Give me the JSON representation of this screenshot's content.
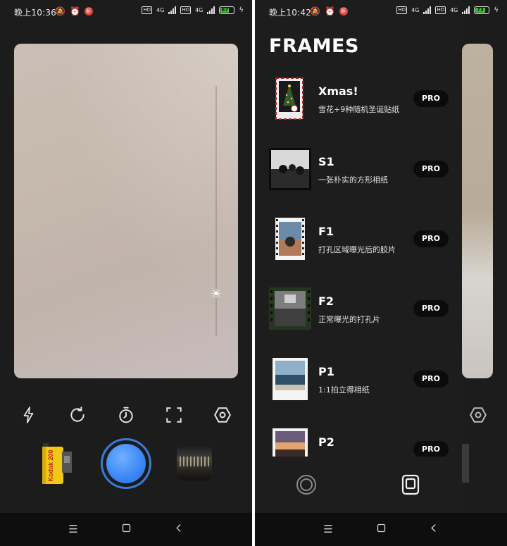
{
  "left": {
    "status": {
      "time": "晚上10:36",
      "notif_badge": "昕",
      "battery": "67",
      "net": "4G"
    },
    "toolbar_icons": [
      "flash-icon",
      "rotate-icon",
      "timer-icon",
      "crop-icon",
      "hexagon-settings-icon"
    ],
    "film_label": "Kodak 200"
  },
  "right": {
    "status": {
      "time": "晚上10:42",
      "notif_badge": "昕",
      "battery": "73",
      "net": "4G"
    },
    "drawer": {
      "title": "FRAMES",
      "items": [
        {
          "name": "Xmas!",
          "desc": "雪花+9种随机圣诞贴纸",
          "badge": "PRO"
        },
        {
          "name": "S1",
          "desc": "一张朴实的方形相纸",
          "badge": "PRO"
        },
        {
          "name": "F1",
          "desc": "打孔区域曝光后的胶片",
          "badge": "PRO"
        },
        {
          "name": "F2",
          "desc": "正常曝光的打孔片",
          "badge": "PRO"
        },
        {
          "name": "P1",
          "desc": "1:1拍立得相纸",
          "badge": "PRO"
        },
        {
          "name": "P2",
          "desc": "",
          "badge": "PRO"
        }
      ]
    }
  },
  "colors": {
    "accent_blue": "#3a86f4",
    "panel": "#1d1d1d",
    "battery_green": "#49c144"
  }
}
